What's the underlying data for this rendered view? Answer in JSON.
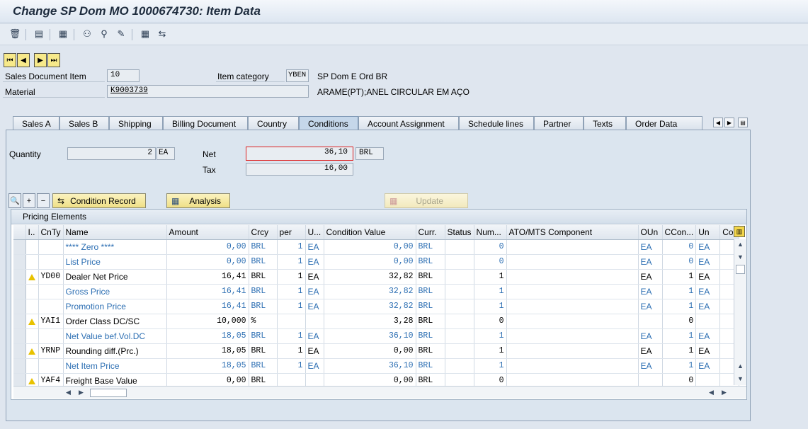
{
  "window": {
    "title": "Change SP Dom MO 1000674730: Item Data"
  },
  "header": {
    "sales_doc_item_label": "Sales Document Item",
    "sales_doc_item_value": "10",
    "item_category_label": "Item category",
    "item_category_value": "YBEN",
    "item_category_desc": "SP Dom E Ord BR",
    "material_label": "Material",
    "material_value": "K9003739",
    "material_desc": "ARAME(PT);ANEL CIRCULAR EM AÇO"
  },
  "tabs": [
    "Sales A",
    "Sales B",
    "Shipping",
    "Billing Document",
    "Country",
    "Conditions",
    "Account Assignment",
    "Schedule lines",
    "Partner",
    "Texts",
    "Order Data"
  ],
  "active_tab": "Conditions",
  "conditions": {
    "quantity_label": "Quantity",
    "quantity_value": "2",
    "quantity_unit": "EA",
    "net_label": "Net",
    "net_value": "36,10",
    "net_currency": "BRL",
    "tax_label": "Tax",
    "tax_value": "16,00",
    "condition_record_label": "Condition Record",
    "analysis_label": "Analysis",
    "update_label": "Update"
  },
  "grid": {
    "title": "Pricing Elements",
    "columns": [
      "I..",
      "CnTy",
      "Name",
      "Amount",
      "Crcy",
      "per",
      "U...",
      "Condition Value",
      "Curr.",
      "Status",
      "Num...",
      "ATO/MTS Component",
      "OUn",
      "CCon...",
      "Un",
      "Cor"
    ],
    "rows": [
      {
        "warn": false,
        "cnty": "",
        "name": "**** Zero ****",
        "amount": "0,00",
        "crcy": "BRL",
        "per": "1",
        "u": "EA",
        "value": "0,00",
        "curr": "BRL",
        "status": "",
        "num": "0",
        "ato": "",
        "oun": "EA",
        "ccon": "0",
        "un": "EA",
        "blue": true
      },
      {
        "warn": false,
        "cnty": "",
        "name": "List Price",
        "amount": "0,00",
        "crcy": "BRL",
        "per": "1",
        "u": "EA",
        "value": "0,00",
        "curr": "BRL",
        "status": "",
        "num": "0",
        "ato": "",
        "oun": "EA",
        "ccon": "0",
        "un": "EA",
        "blue": true
      },
      {
        "warn": true,
        "cnty": "YD00",
        "name": "Dealer Net Price",
        "amount": "16,41",
        "crcy": "BRL",
        "per": "1",
        "u": "EA",
        "value": "32,82",
        "curr": "BRL",
        "status": "",
        "num": "1",
        "ato": "",
        "oun": "EA",
        "ccon": "1",
        "un": "EA",
        "blue": false
      },
      {
        "warn": false,
        "cnty": "",
        "name": "Gross Price",
        "amount": "16,41",
        "crcy": "BRL",
        "per": "1",
        "u": "EA",
        "value": "32,82",
        "curr": "BRL",
        "status": "",
        "num": "1",
        "ato": "",
        "oun": "EA",
        "ccon": "1",
        "un": "EA",
        "blue": true
      },
      {
        "warn": false,
        "cnty": "",
        "name": "Promotion Price",
        "amount": "16,41",
        "crcy": "BRL",
        "per": "1",
        "u": "EA",
        "value": "32,82",
        "curr": "BRL",
        "status": "",
        "num": "1",
        "ato": "",
        "oun": "EA",
        "ccon": "1",
        "un": "EA",
        "blue": true
      },
      {
        "warn": true,
        "cnty": "YAI1",
        "name": "Order Class DC/SC",
        "amount": "10,000",
        "crcy": "%",
        "per": "",
        "u": "",
        "value": "3,28",
        "curr": "BRL",
        "status": "",
        "num": "0",
        "ato": "",
        "oun": "",
        "ccon": "0",
        "un": "",
        "blue": false
      },
      {
        "warn": false,
        "cnty": "",
        "name": "Net Value bef.Vol.DC",
        "amount": "18,05",
        "crcy": "BRL",
        "per": "1",
        "u": "EA",
        "value": "36,10",
        "curr": "BRL",
        "status": "",
        "num": "1",
        "ato": "",
        "oun": "EA",
        "ccon": "1",
        "un": "EA",
        "blue": true
      },
      {
        "warn": true,
        "cnty": "YRNP",
        "name": "Rounding diff.(Prc.)",
        "amount": "18,05",
        "crcy": "BRL",
        "per": "1",
        "u": "EA",
        "value": "0,00",
        "curr": "BRL",
        "status": "",
        "num": "1",
        "ato": "",
        "oun": "EA",
        "ccon": "1",
        "un": "EA",
        "blue": false
      },
      {
        "warn": false,
        "cnty": "",
        "name": "Net Item Price",
        "amount": "18,05",
        "crcy": "BRL",
        "per": "1",
        "u": "EA",
        "value": "36,10",
        "curr": "BRL",
        "status": "",
        "num": "1",
        "ato": "",
        "oun": "EA",
        "ccon": "1",
        "un": "EA",
        "blue": true
      },
      {
        "warn": true,
        "cnty": "YAF4",
        "name": "Freight Base Value",
        "amount": "0,00",
        "crcy": "BRL",
        "per": "",
        "u": "",
        "value": "0,00",
        "curr": "BRL",
        "status": "",
        "num": "0",
        "ato": "",
        "oun": "",
        "ccon": "0",
        "un": "",
        "blue": false
      }
    ]
  },
  "colors": {
    "accent_blue": "#2d6fb3",
    "warning_yellow": "#e8c200",
    "button_yellow": "#f7e98a"
  }
}
